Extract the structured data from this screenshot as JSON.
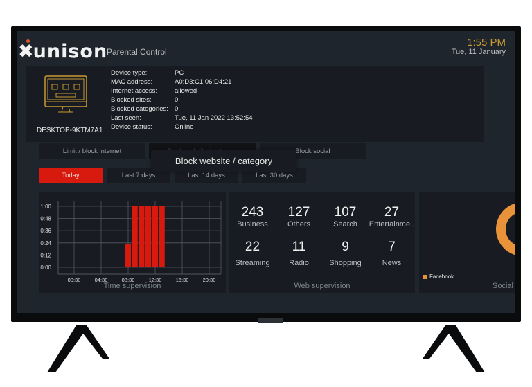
{
  "header": {
    "brand": "xunison",
    "subtitle": "Parental Control",
    "time": "1:55 PM",
    "date": "Tue, 11 January"
  },
  "device": {
    "name": "DESKTOP-9KTM7A1",
    "icon": "monitor-icon",
    "fields": [
      {
        "label": "Device type:",
        "value": "PC"
      },
      {
        "label": "MAC address:",
        "value": "A0:D3:C1:06:D4:21"
      },
      {
        "label": "Internet access:",
        "value": "allowed"
      },
      {
        "label": "Blocked sites:",
        "value": "0"
      },
      {
        "label": "Blocked categories:",
        "value": "0"
      },
      {
        "label": "Last seen:",
        "value": "Tue, 11 Jan 2022 13:52:54"
      },
      {
        "label": "Device status:",
        "value": "Online"
      }
    ]
  },
  "actions": [
    "Limit / block internet",
    "Block website / category",
    "Block social"
  ],
  "tooltip": "Block website / category",
  "ranges": {
    "items": [
      "Today",
      "Last 7 days",
      "Last 14 days",
      "Last 30 days"
    ],
    "selected": "Today",
    "accent": "#d7190e"
  },
  "chart_data": {
    "type": "bar",
    "title": "Time supervision",
    "x_ticks": [
      "00:30",
      "04:30",
      "08:30",
      "12:30",
      "16:30",
      "20:30"
    ],
    "y_ticks": [
      "0:00",
      "0:12",
      "0:24",
      "0:36",
      "0:48",
      "1:00"
    ],
    "ylim_minutes": [
      0,
      60
    ],
    "grid": true,
    "x": [
      "08:30",
      "09:30",
      "10:30",
      "11:30",
      "12:30",
      "13:30"
    ],
    "values_minutes": [
      23,
      60,
      60,
      60,
      60,
      60
    ],
    "color": "#d7190e"
  },
  "web": {
    "title": "Web supervision",
    "stats": [
      {
        "n": "243",
        "l": "Business"
      },
      {
        "n": "127",
        "l": "Others"
      },
      {
        "n": "107",
        "l": "Search"
      },
      {
        "n": "27",
        "l": "Entertainme.."
      },
      {
        "n": "22",
        "l": "Streaming"
      },
      {
        "n": "11",
        "l": "Radio"
      },
      {
        "n": "9",
        "l": "Shopping"
      },
      {
        "n": "7",
        "l": "News"
      }
    ]
  },
  "social": {
    "title": "Social",
    "legend": "Facebook",
    "color": "#e8923a"
  }
}
